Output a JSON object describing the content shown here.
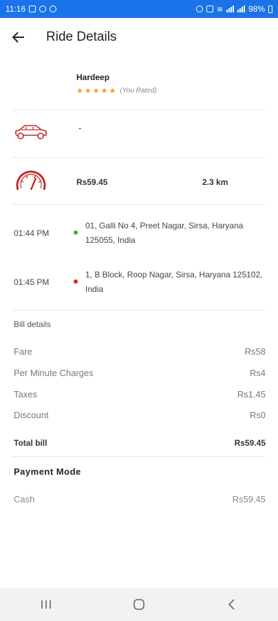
{
  "status_bar": {
    "time": "11:16",
    "battery": "98%"
  },
  "header": {
    "title": "Ride Details"
  },
  "driver": {
    "name": "Hardeep",
    "stars": "★★★★★",
    "rated_label": "(You Rated)"
  },
  "vehicle": {
    "value": "-"
  },
  "trip": {
    "fare": "Rs59.45",
    "distance": "2.3 km"
  },
  "stops": [
    {
      "time": "01:44 PM",
      "address": "01, Galli No 4, Preet Nagar, Sirsa, Haryana 125055, India",
      "dot_color": "#2db52d"
    },
    {
      "time": "01:45 PM",
      "address": "1, B Block, Roop Nagar, Sirsa, Haryana 125102, India",
      "dot_color": "#e21b1b"
    }
  ],
  "bill": {
    "title": "Bill details",
    "rows": [
      {
        "label": "Fare",
        "value": "Rs58"
      },
      {
        "label": "Per Minute Charges",
        "value": "Rs4"
      },
      {
        "label": "Taxes",
        "value": "Rs1.45"
      },
      {
        "label": "Discount",
        "value": "Rs0"
      }
    ],
    "total_label": "Total bill",
    "total_value": "Rs59.45"
  },
  "payment": {
    "title": "Payment Mode",
    "method": "Cash",
    "amount": "Rs59.45"
  },
  "colors": {
    "status_bar": "#1a73e8",
    "accent": "#c62828",
    "star": "#f39a1e"
  }
}
